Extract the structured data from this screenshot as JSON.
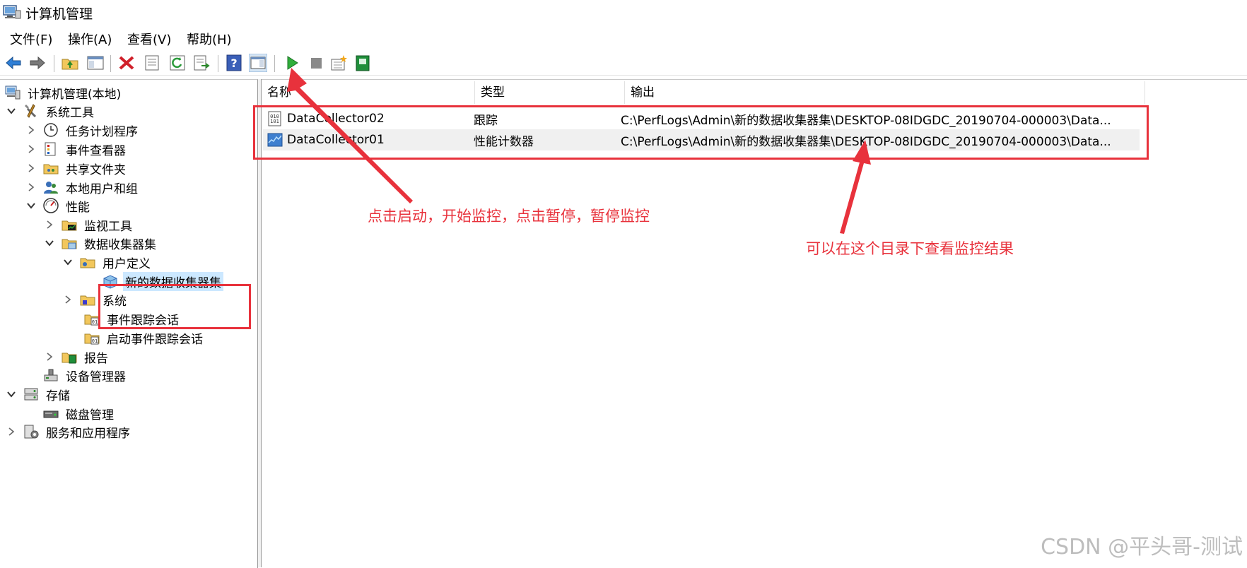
{
  "window": {
    "title": "计算机管理"
  },
  "menu": [
    {
      "label": "文件(F)"
    },
    {
      "label": "操作(A)"
    },
    {
      "label": "查看(V)"
    },
    {
      "label": "帮助(H)"
    }
  ],
  "toolbar": {
    "buttons": [
      "back-icon",
      "forward-icon",
      "up-folder-icon",
      "show-hide-tree-icon",
      "delete-icon",
      "properties-icon",
      "refresh-icon",
      "export-list-icon",
      "help-icon",
      "action-pane-icon",
      "start-icon",
      "stop-icon",
      "new-icon",
      "report-icon"
    ]
  },
  "tree": {
    "root": "计算机管理(本地)",
    "system_tools": "系统工具",
    "task_scheduler": "任务计划程序",
    "event_viewer": "事件查看器",
    "shared_folders": "共享文件夹",
    "local_users": "本地用户和组",
    "performance": "性能",
    "monitoring_tools": "监视工具",
    "data_collector_sets": "数据收集器集",
    "user_defined": "用户定义",
    "new_set": "新的数据收集器集",
    "system": "系统",
    "event_trace": "事件跟踪会话",
    "startup_trace": "启动事件跟踪会话",
    "reports": "报告",
    "device_manager": "设备管理器",
    "storage": "存储",
    "disk_management": "磁盘管理",
    "services_apps": "服务和应用程序"
  },
  "list": {
    "columns": [
      "名称",
      "类型",
      "输出"
    ],
    "rows": [
      {
        "name": "DataCollector02",
        "type": "跟踪",
        "output": "C:\\PerfLogs\\Admin\\新的数据收集器集\\DESKTOP-08IDGDC_20190704-000003\\Data..."
      },
      {
        "name": "DataCollector01",
        "type": "性能计数器",
        "output": "C:\\PerfLogs\\Admin\\新的数据收集器集\\DESKTOP-08IDGDC_20190704-000003\\Data..."
      }
    ]
  },
  "annotations": {
    "start_note": "点击启动，开始监控，点击暂停，暂停监控",
    "output_note": "可以在这个目录下查看监控结果",
    "color": "#e8323c"
  },
  "watermark": "CSDN @平头哥-测试"
}
